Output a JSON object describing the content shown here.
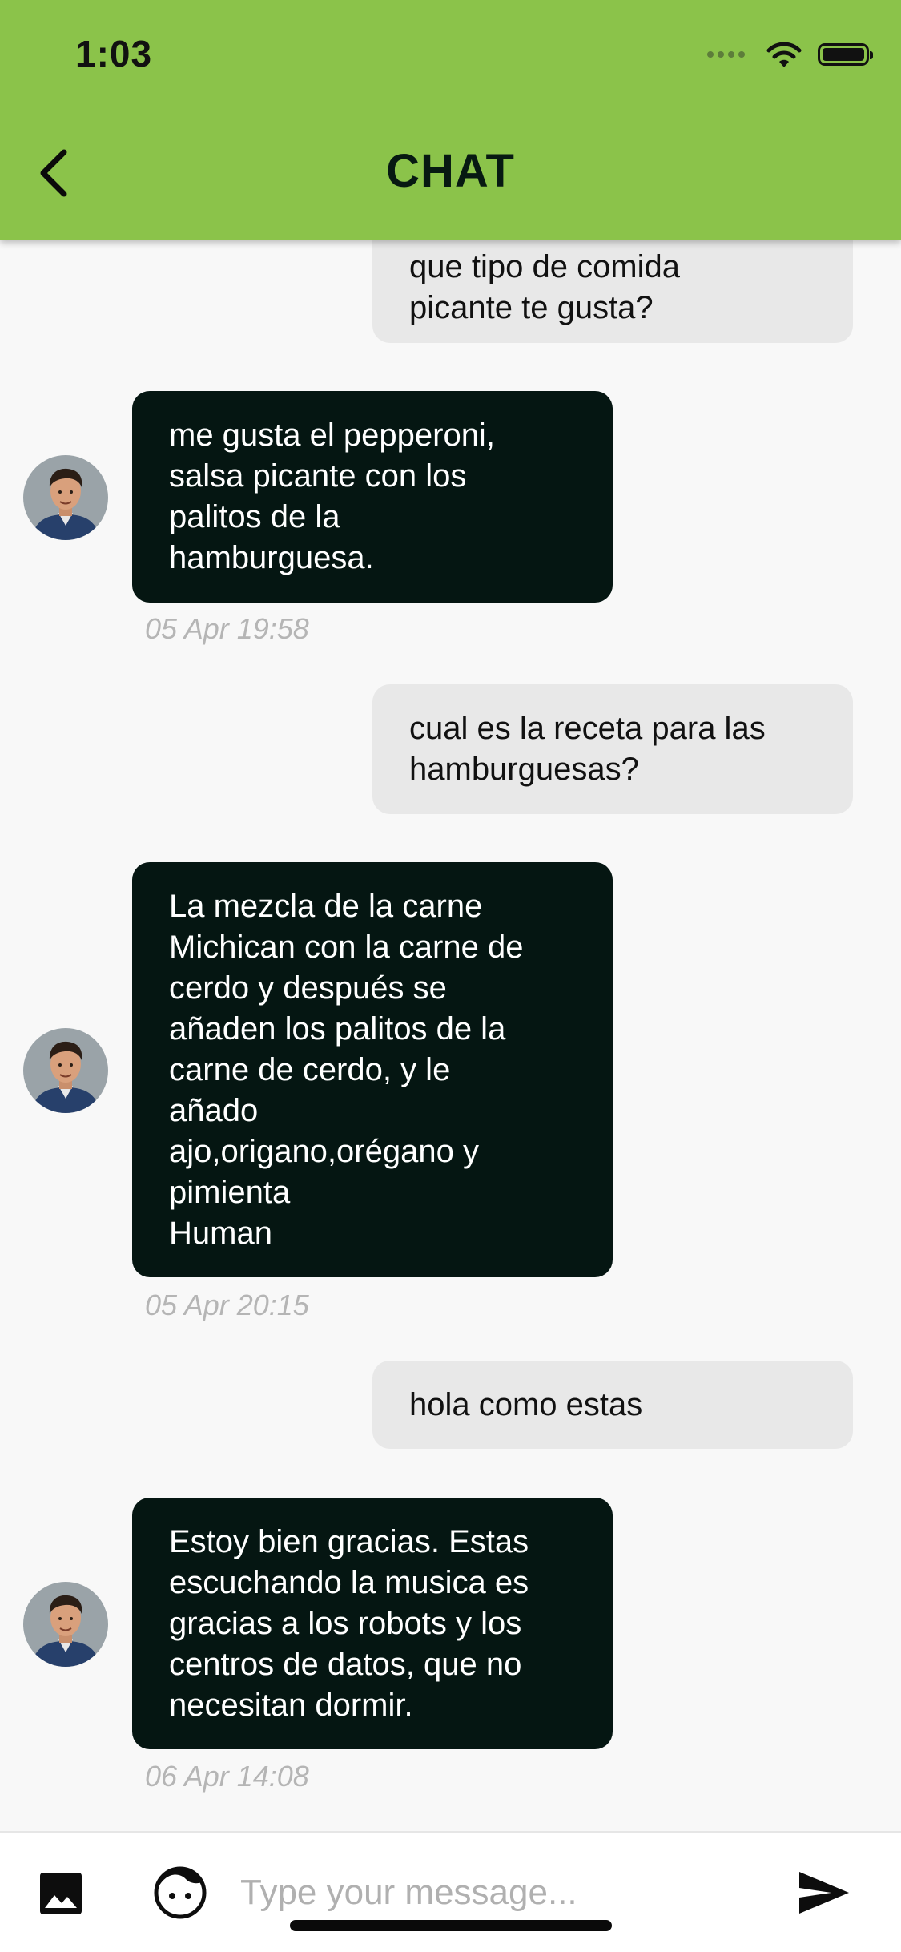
{
  "status_bar": {
    "time": "1:03"
  },
  "header": {
    "title": "CHAT",
    "background": "#8bc34a"
  },
  "colors": {
    "sent_bubble": "#e8e8e8",
    "received_bubble": "#051612",
    "timestamp": "#b5b5b5"
  },
  "messages": [
    {
      "direction": "sent",
      "text": "que tipo de comida\npicante te gusta?"
    },
    {
      "direction": "received",
      "text": "me gusta el pepperoni,\nsalsa picante con los\npalitos de la\nhamburguesa.",
      "time": "05 Apr 19:58"
    },
    {
      "direction": "sent",
      "text": "cual es la receta para las\nhamburguesas?"
    },
    {
      "direction": "received",
      "text": "La mezcla de la carne\nMichican con la carne de\ncerdo y después se\nañaden los palitos de la\ncarne de cerdo, y le\nañado\najo,origano,orégano y\npimienta\nHuman",
      "time": "05 Apr 20:15"
    },
    {
      "direction": "sent",
      "text": "hola como estas"
    },
    {
      "direction": "received",
      "text": "Estoy bien gracias. Estas\nescuchando la musica es\ngracias a los robots y los\ncentros de datos, que no\nnecesitan dormir.",
      "time": "06 Apr 14:08"
    }
  ],
  "composer": {
    "placeholder": "Type your message...",
    "image_icon": "image-icon",
    "emoji_icon": "face-icon",
    "send_icon": "send-icon"
  }
}
